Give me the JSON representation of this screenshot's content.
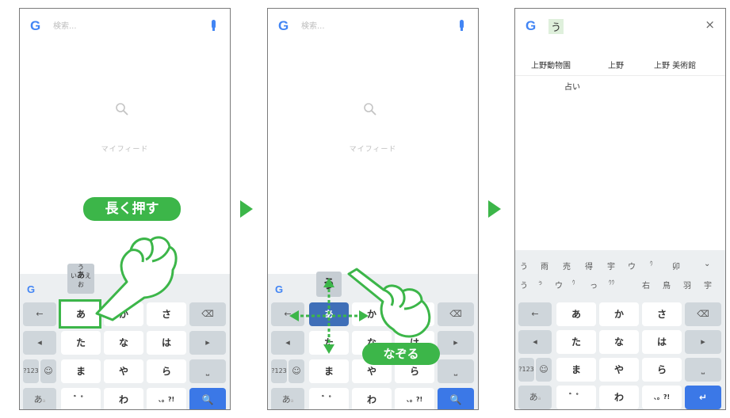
{
  "search": {
    "logo": "G",
    "placeholder": "検索..."
  },
  "home": {
    "hint": "マイフィード"
  },
  "callouts": {
    "long_press": "長く押す",
    "swipe": "なぞる"
  },
  "popup1": {
    "top": "う",
    "left": "い",
    "center": "あ",
    "right": "え",
    "bottom": "お"
  },
  "popup2": {
    "top": "う"
  },
  "keyboard": {
    "g_logo": "G",
    "left_key": "←",
    "del_key": "⌫",
    "prev_key": "◂",
    "next_key": "▸",
    "num_key": "?123",
    "emoji_key": "☺",
    "space_key": "⎵",
    "mode_key": "あ",
    "mode_sub": "a",
    "search_key": "🔍",
    "enter_key": "↵",
    "rows": [
      [
        "あ",
        "か",
        "さ"
      ],
      [
        "た",
        "な",
        "は"
      ],
      [
        "ま",
        "や",
        "ら"
      ],
      [
        "゛゜",
        "わ",
        "、。?!"
      ]
    ]
  },
  "result": {
    "query": "う",
    "close": "×",
    "suggestions": [
      "上野動物園",
      "上野",
      "上野 美術館"
    ],
    "suggestion_extra": "占い",
    "candidates_row1": [
      "う",
      "雨",
      "売",
      "得",
      "宇",
      "ウ",
      "ｳ",
      "卯",
      "⌄"
    ],
    "candidates_row2": [
      "う",
      "ぅ",
      "ウ",
      "ｳ",
      "っ",
      "ｳｳ",
      "右",
      "鳥",
      "羽",
      "宇"
    ]
  },
  "colors": {
    "accent_green": "#3cb649",
    "google_blue": "#4285f4",
    "keyboard_bg": "#eceff1",
    "enter_blue": "#3b78e7"
  }
}
